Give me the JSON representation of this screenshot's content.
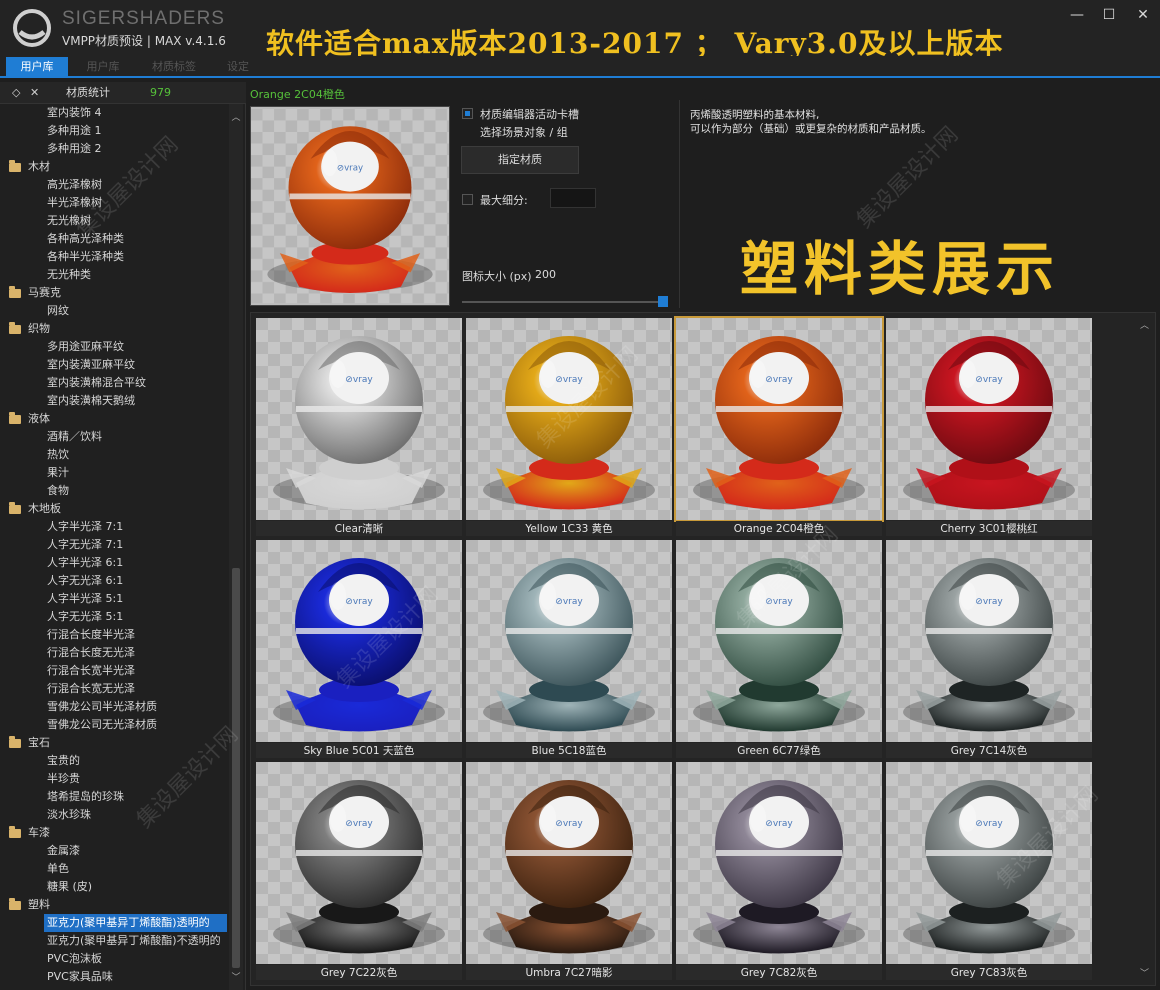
{
  "window": {
    "brand": "SIGERSHADERS",
    "subtitle": "VMPP材质预设 | MAX v.4.1.6",
    "banner": "软件适合max版本2013-2017 ； Vary3.0及以上版本",
    "min_glyph": "—",
    "max_glyph": "☐",
    "close_glyph": "✕"
  },
  "tabs": [
    {
      "label": "用户库",
      "active": true
    },
    {
      "label": "用户库",
      "active": false
    },
    {
      "label": "材质标签",
      "active": false
    },
    {
      "label": "设定",
      "active": false
    }
  ],
  "sidebar": {
    "header_label": "材质统计",
    "header_count": "979",
    "header_icon_a": "◇",
    "header_icon_b": "✕",
    "tree": [
      {
        "label": "室内装饰 4",
        "type": "item"
      },
      {
        "label": "多种用途 1",
        "type": "item"
      },
      {
        "label": "多种用途 2",
        "type": "item"
      },
      {
        "label": "木材",
        "type": "cat"
      },
      {
        "label": "高光泽橡树",
        "type": "item"
      },
      {
        "label": "半光泽橡树",
        "type": "item"
      },
      {
        "label": "无光橡树",
        "type": "item"
      },
      {
        "label": "各种高光泽种类",
        "type": "item"
      },
      {
        "label": "各种半光泽种类",
        "type": "item"
      },
      {
        "label": "无光种类",
        "type": "item"
      },
      {
        "label": "马赛克",
        "type": "cat"
      },
      {
        "label": "网纹",
        "type": "item"
      },
      {
        "label": "织物",
        "type": "cat"
      },
      {
        "label": "多用途亚麻平纹",
        "type": "item"
      },
      {
        "label": "室内装潢亚麻平纹",
        "type": "item"
      },
      {
        "label": "室内装潢棉混合平纹",
        "type": "item"
      },
      {
        "label": "室内装潢棉天鹅绒",
        "type": "item"
      },
      {
        "label": "液体",
        "type": "cat"
      },
      {
        "label": "酒精／饮料",
        "type": "item"
      },
      {
        "label": "热饮",
        "type": "item"
      },
      {
        "label": "果汁",
        "type": "item"
      },
      {
        "label": "食物",
        "type": "item"
      },
      {
        "label": "木地板",
        "type": "cat"
      },
      {
        "label": "人字半光泽 7:1",
        "type": "item"
      },
      {
        "label": "人字无光泽 7:1",
        "type": "item"
      },
      {
        "label": "人字半光泽 6:1",
        "type": "item"
      },
      {
        "label": "人字无光泽 6:1",
        "type": "item"
      },
      {
        "label": "人字半光泽 5:1",
        "type": "item"
      },
      {
        "label": "人字无光泽 5:1",
        "type": "item"
      },
      {
        "label": "行混合长度半光泽",
        "type": "item"
      },
      {
        "label": "行混合长度无光泽",
        "type": "item"
      },
      {
        "label": "行混合长宽半光泽",
        "type": "item"
      },
      {
        "label": "行混合长宽无光泽",
        "type": "item"
      },
      {
        "label": "雪佛龙公司半光泽材质",
        "type": "item"
      },
      {
        "label": "雪佛龙公司无光泽材质",
        "type": "item"
      },
      {
        "label": "宝石",
        "type": "cat"
      },
      {
        "label": "宝贵的",
        "type": "item"
      },
      {
        "label": "半珍贵",
        "type": "item"
      },
      {
        "label": "塔希提岛的珍珠",
        "type": "item"
      },
      {
        "label": "淡水珍珠",
        "type": "item"
      },
      {
        "label": "车漆",
        "type": "cat"
      },
      {
        "label": "金属漆",
        "type": "item"
      },
      {
        "label": "单色",
        "type": "item"
      },
      {
        "label": "糖果 (皮)",
        "type": "item"
      },
      {
        "label": "塑料",
        "type": "cat"
      },
      {
        "label": "亚克力(聚甲基异丁烯酸酯)透明的",
        "type": "item",
        "selected": true
      },
      {
        "label": "亚克力(聚甲基异丁烯酸酯)不透明的",
        "type": "item"
      },
      {
        "label": "PVC泡沫板",
        "type": "item"
      },
      {
        "label": "PVC家具品味",
        "type": "item"
      }
    ]
  },
  "main": {
    "crumb": "Orange 2C04橙色",
    "opt_editor": "材质编辑器活动卡槽",
    "opt_select": "选择场景对象 / 组",
    "assign_label": "指定材质",
    "max_subdiv_label": "最大细分:",
    "icon_size_label": "图标大小 (px)",
    "icon_size_value": "200",
    "icon_size_fraction": 1.0,
    "desc_line1": "丙烯酸透明塑料的基本材料,",
    "desc_line2": "可以作为部分（基础）或更复杂的材质和产品材质。",
    "big_title": "塑料类展示"
  },
  "materials": [
    {
      "label": "Clear清晰",
      "color": "#d8d8d8",
      "dark": "#6a6a6a",
      "base": "#cfcfcf"
    },
    {
      "label": "Yellow 1C33 黄色",
      "color": "#e2a818",
      "dark": "#8a5a0a",
      "base": "#d42a1a"
    },
    {
      "label": "Orange 2C04橙色",
      "color": "#e0621a",
      "dark": "#8a2a0a",
      "base": "#d42a1a",
      "selected": true
    },
    {
      "label": "Cherry 3C01樱桃红",
      "color": "#c81520",
      "dark": "#6a0a10",
      "base": "#b01018"
    },
    {
      "label": "Sky Blue 5C01 天蓝色",
      "color": "#1a2ad8",
      "dark": "#0a0e6a",
      "base": "#1a20c0"
    },
    {
      "label": "Blue 5C18蓝色",
      "color": "#9fb4b8",
      "dark": "#3a5258",
      "base": "#2e4a52"
    },
    {
      "label": "Green 6C77绿色",
      "color": "#8fa89c",
      "dark": "#2e4a3e",
      "base": "#213a30"
    },
    {
      "label": "Grey 7C14灰色",
      "color": "#9aa2a2",
      "dark": "#3a4242",
      "base": "#1e2424"
    },
    {
      "label": "Grey 7C22灰色",
      "color": "#7e7e7e",
      "dark": "#2a2a2a",
      "base": "#181818"
    },
    {
      "label": "Umbra 7C27暗影",
      "color": "#8a5232",
      "dark": "#3a200e",
      "base": "#2a1a10"
    },
    {
      "label": "Grey 7C82灰色",
      "color": "#8e8696",
      "dark": "#3a3442",
      "base": "#1e1a24"
    },
    {
      "label": "Grey 7C83灰色",
      "color": "#939a9a",
      "dark": "#3a4040",
      "base": "#1c2020"
    }
  ],
  "watermark": "集设屋设计网"
}
